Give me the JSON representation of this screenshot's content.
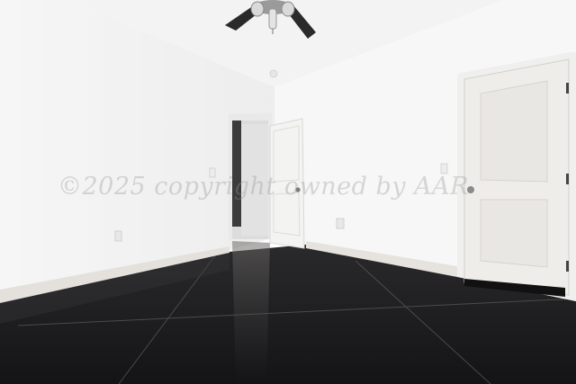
{
  "photo": {
    "subject": "empty room",
    "watermark": "©2025 copyright owned by AAR",
    "colors": {
      "wall_left": "#f2f2f2",
      "wall_right": "#f7f7f7",
      "ceiling": "#f4f4f4",
      "floor": "#1c1b1d",
      "door": "#ececea",
      "baseboard": "#e6e3de",
      "fan": "#2a2a2a"
    }
  }
}
